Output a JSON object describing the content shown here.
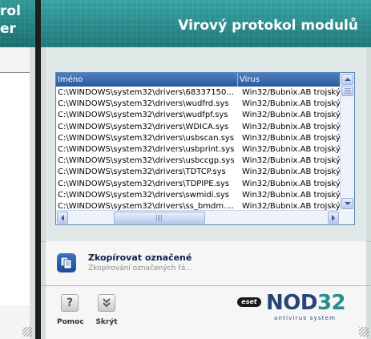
{
  "left_window": {
    "title_line1": "rol",
    "title_line2": "er"
  },
  "main_window": {
    "title": "Virový protokol modulů"
  },
  "list": {
    "columns": [
      "Iméno",
      "Virus"
    ],
    "rows": [
      {
        "name": "C:\\WINDOWS\\system32\\drivers\\68337150...",
        "virus": "Win32/Bubnix.AB trojský"
      },
      {
        "name": "C:\\WINDOWS\\system32\\drivers\\wudfrd.sys",
        "virus": "Win32/Bubnix.AB trojský"
      },
      {
        "name": "C:\\WINDOWS\\system32\\drivers\\wudfpf.sys",
        "virus": "Win32/Bubnix.AB trojský"
      },
      {
        "name": "C:\\WINDOWS\\system32\\drivers\\WDICA.sys",
        "virus": "Win32/Bubnix.AB trojský"
      },
      {
        "name": "C:\\WINDOWS\\system32\\drivers\\usbscan.sys",
        "virus": "Win32/Bubnix.AB trojský"
      },
      {
        "name": "C:\\WINDOWS\\system32\\drivers\\usbprint.sys",
        "virus": "Win32/Bubnix.AB trojský"
      },
      {
        "name": "C:\\WINDOWS\\system32\\drivers\\usbccgp.sys",
        "virus": "Win32/Bubnix.AB trojský"
      },
      {
        "name": "C:\\WINDOWS\\system32\\drivers\\TDTCP.sys",
        "virus": "Win32/Bubnix.AB trojský"
      },
      {
        "name": "C:\\WINDOWS\\system32\\drivers\\TDPIPE.sys",
        "virus": "Win32/Bubnix.AB trojský"
      },
      {
        "name": "C:\\WINDOWS\\system32\\drivers\\swmidi.sys",
        "virus": "Win32/Bubnix.AB trojský"
      },
      {
        "name": "C:\\WINDOWS\\system32\\drivers\\ss_bmdm....",
        "virus": "Win32/Bubnix.AB trojský"
      }
    ]
  },
  "action": {
    "title": "Zkopírovat označené",
    "description": "Zkopírování označených řá...",
    "icon": "copy-icon"
  },
  "bottom": {
    "help_label": "Pomoc",
    "close_label": "Skrýt",
    "help_glyph": "?"
  },
  "logo": {
    "badge": "eset",
    "name_letters": "NOD",
    "name_digits": "32",
    "tagline": "antivirus system"
  },
  "colors": {
    "header_teal": "#2a8888",
    "list_header_blue": "#2a5a9c",
    "logo_navy": "#25457a",
    "logo_teal": "#2b8c8c"
  }
}
